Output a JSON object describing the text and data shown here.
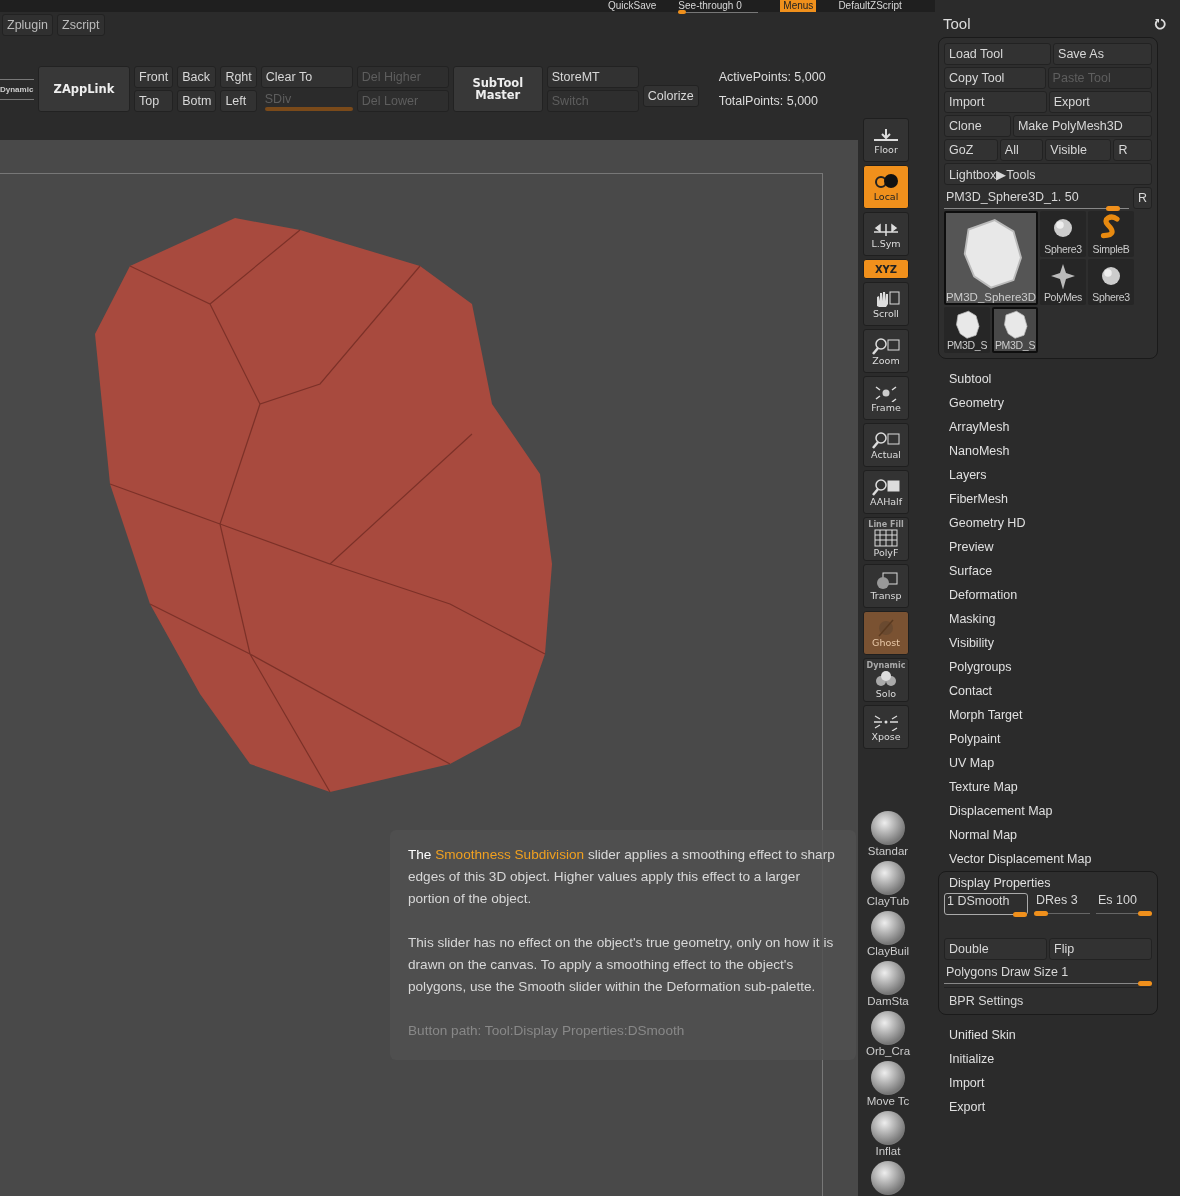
{
  "top_bar": [
    {
      "kind": "text",
      "label": "QuickSave"
    },
    {
      "kind": "slider",
      "label": "See-through  0",
      "level": 0.1
    },
    {
      "kind": "toggle",
      "label": "Menus",
      "on": true
    },
    {
      "kind": "text",
      "label": "DefaultZScript"
    }
  ],
  "menus": [
    {
      "label": "Zplugin"
    },
    {
      "label": "Zscript"
    }
  ],
  "shelf": {
    "dynamic": "Dynamic",
    "zapplink": "ZAppLink",
    "views": [
      {
        "label": "Front"
      },
      {
        "label": "Back"
      },
      {
        "label": "Rght"
      },
      {
        "label": "Top"
      },
      {
        "label": "Botm"
      },
      {
        "label": "Left"
      }
    ],
    "clear_to": {
      "label": "Clear To",
      "disabled": false
    },
    "sdiv": {
      "label": "SDiv",
      "disabled": true,
      "level": 1
    },
    "del_higher": {
      "label": "Del Higher",
      "disabled": true
    },
    "del_lower": {
      "label": "Del Lower",
      "disabled": true
    },
    "subtool_master": "SubTool Master",
    "store_mt": {
      "label": "StoreMT",
      "disabled": false
    },
    "switch": {
      "label": "Switch",
      "disabled": true
    },
    "colorize": {
      "label": "Colorize",
      "disabled": false
    },
    "active_points": "ActivePoints: 5,000",
    "total_points": "TotalPoints: 5,000"
  },
  "right_shelf": [
    {
      "kind": "floor",
      "label": "Floor",
      "on": false
    },
    {
      "kind": "local",
      "label": "Local",
      "on": true
    },
    {
      "kind": "lsym",
      "label": "L.Sym",
      "on": false
    },
    {
      "kind": "xyz",
      "label": "XYZ",
      "on": true
    },
    {
      "kind": "scroll",
      "label": "Scroll",
      "on": false
    },
    {
      "kind": "zoom",
      "label": "Zoom",
      "on": false
    },
    {
      "kind": "frame",
      "label": "Frame",
      "on": false
    },
    {
      "kind": "actual",
      "label": "Actual",
      "on": false
    },
    {
      "kind": "aahalf",
      "label": "AAHalf",
      "on": false
    },
    {
      "kind": "polyf",
      "label": "PolyF",
      "caption": "Line Fill",
      "on": false
    },
    {
      "kind": "transp",
      "label": "Transp",
      "on": false
    },
    {
      "kind": "ghost",
      "label": "Ghost",
      "on": true
    },
    {
      "kind": "solo",
      "label": "Solo",
      "caption": "Dynamic",
      "on": false
    },
    {
      "kind": "xpose",
      "label": "Xpose",
      "on": false
    }
  ],
  "brushes": [
    {
      "label": "Standar"
    },
    {
      "label": "ClayTub"
    },
    {
      "label": "ClayBuil"
    },
    {
      "label": "DamSta"
    },
    {
      "label": "Orb_Cra"
    },
    {
      "label": "Move Tc"
    },
    {
      "label": "Inflat"
    }
  ],
  "tooltip": {
    "intro": "The",
    "highlight": "Smoothness Subdivision",
    "rest": "slider applies a smoothing effect to sharp edges of this 3D object. Higher values apply this effect to a larger portion of the object.",
    "paragraph_2": "This slider has no effect on the object's true geometry, only on how it is drawn on the canvas. To apply a smoothing effect to the object's polygons, use the Smooth slider within the Deformation sub-palette.",
    "path": "Button path: Tool:Display Properties:DSmooth"
  },
  "tool_panel": {
    "title": "Tool",
    "button_rows": [
      [
        {
          "label": "Load Tool",
          "disabled": false
        },
        {
          "label": "Save As",
          "disabled": false
        }
      ],
      [
        {
          "label": "Copy Tool",
          "disabled": false
        },
        {
          "label": "Paste Tool",
          "disabled": true
        }
      ],
      [
        {
          "label": "Import",
          "disabled": false
        },
        {
          "label": "Export",
          "disabled": false
        }
      ],
      [
        {
          "label": "Clone",
          "disabled": false
        },
        {
          "label": "Make PolyMesh3D",
          "disabled": false
        }
      ],
      [
        {
          "label": "GoZ",
          "disabled": false
        },
        {
          "label": "All",
          "disabled": false
        },
        {
          "label": "Visible",
          "disabled": false
        },
        {
          "label": "R",
          "disabled": false
        }
      ],
      [
        {
          "label": "Lightbox▶Tools",
          "disabled": false
        }
      ]
    ],
    "tool_slider": {
      "label": "PM3D_Sphere3D_1. 50",
      "level": 0.95,
      "reset": "R"
    },
    "thumbnails": [
      {
        "kind": "rock",
        "label": "PM3D_Sphere3D",
        "selected": true
      },
      {
        "kind": "sphere",
        "label": "Sphere3",
        "selected": false
      },
      {
        "kind": "snake",
        "label": "SimpleB",
        "selected": false
      },
      {
        "kind": "star",
        "label": "PolyMes",
        "selected": false
      },
      {
        "kind": "sphere",
        "label": "Sphere3",
        "selected": false
      },
      {
        "kind": "rock",
        "label": "PM3D_S",
        "selected": false
      },
      {
        "kind": "rock",
        "label": "PM3D_S",
        "selected": true
      }
    ],
    "subpalettes": [
      "Subtool",
      "Geometry",
      "ArrayMesh",
      "NanoMesh",
      "Layers",
      "FiberMesh",
      "Geometry HD",
      "Preview",
      "Surface",
      "Deformation",
      "Masking",
      "Visibility",
      "Polygroups",
      "Contact",
      "Morph Target",
      "Polypaint",
      "UV Map",
      "Texture Map",
      "Displacement Map",
      "Normal Map",
      "Vector Displacement Map"
    ],
    "display_properties": {
      "title": "Display Properties",
      "sliders": [
        {
          "label": "1 DSmooth",
          "level": 1,
          "selected": true
        },
        {
          "label": "DRes 3",
          "level": 0.25,
          "selected": false
        },
        {
          "label": "Es 100",
          "level": 1,
          "selected": false
        }
      ],
      "buttons": [
        {
          "label": "Double",
          "selected": false
        },
        {
          "label": "Flip",
          "selected": false
        }
      ],
      "draw_size": {
        "label": "Polygons Draw Size 1",
        "level": 1
      },
      "bpr": "BPR Settings"
    },
    "more_subpalettes": [
      "Unified Skin",
      "Initialize",
      "Import",
      "Export"
    ]
  }
}
